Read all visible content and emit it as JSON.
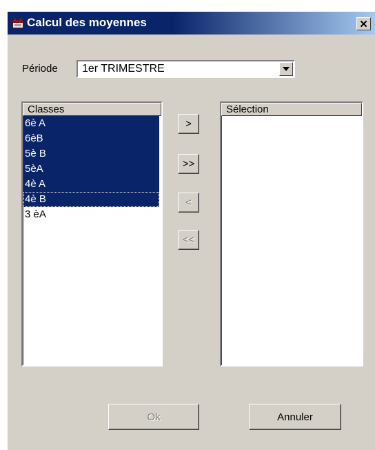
{
  "window": {
    "title": "Calcul des moyennes",
    "close_glyph": "✕"
  },
  "periode": {
    "label": "Période",
    "selected": "1er TRIMESTRE"
  },
  "classes": {
    "header": "Classes",
    "items": [
      {
        "label": "6è A",
        "selected": true
      },
      {
        "label": "6èB",
        "selected": true
      },
      {
        "label": "5è B",
        "selected": true
      },
      {
        "label": "5èA",
        "selected": true
      },
      {
        "label": "4è A",
        "selected": true
      },
      {
        "label": "4è B",
        "selected": true,
        "focused": true
      },
      {
        "label": "3 èA",
        "selected": false
      }
    ]
  },
  "selection": {
    "header": "Sélection",
    "items": []
  },
  "transfer": {
    "add_one": ">",
    "add_all": ">>",
    "remove_one": "<",
    "remove_all": "<<"
  },
  "footer": {
    "ok": "Ok",
    "cancel": "Annuler"
  },
  "colors": {
    "title_bar": "#0a246a",
    "selection": "#0a246a",
    "face": "#d4d0c8"
  }
}
